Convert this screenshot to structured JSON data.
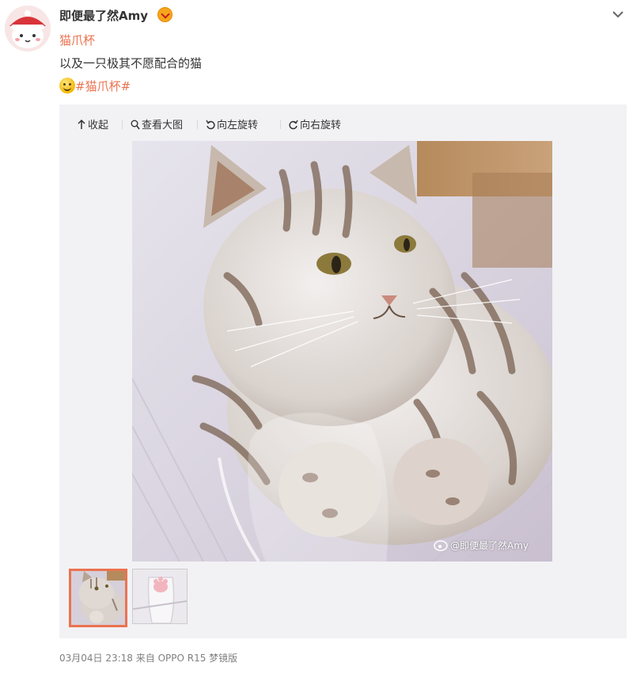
{
  "post": {
    "username": "即便最了然Amy",
    "topic": "猫爪杯",
    "text": "以及一只极其不愿配合的猫",
    "hashtag": "#猫爪杯#"
  },
  "media_toolbar": {
    "collapse": "收起",
    "view_large": "查看大图",
    "rotate_left": "向左旋转",
    "rotate_right": "向右旋转"
  },
  "photo": {
    "watermark": "@即便最了然Amy",
    "thumbnail_count": 2,
    "selected_thumbnail": 1
  },
  "footer": {
    "timestamp": "03月04日 23:18",
    "source": "来自 OPPO R15 梦镜版"
  },
  "colors": {
    "accent": "#eb7350",
    "media_bg": "#f2f2f5",
    "muted_text": "#808080"
  }
}
